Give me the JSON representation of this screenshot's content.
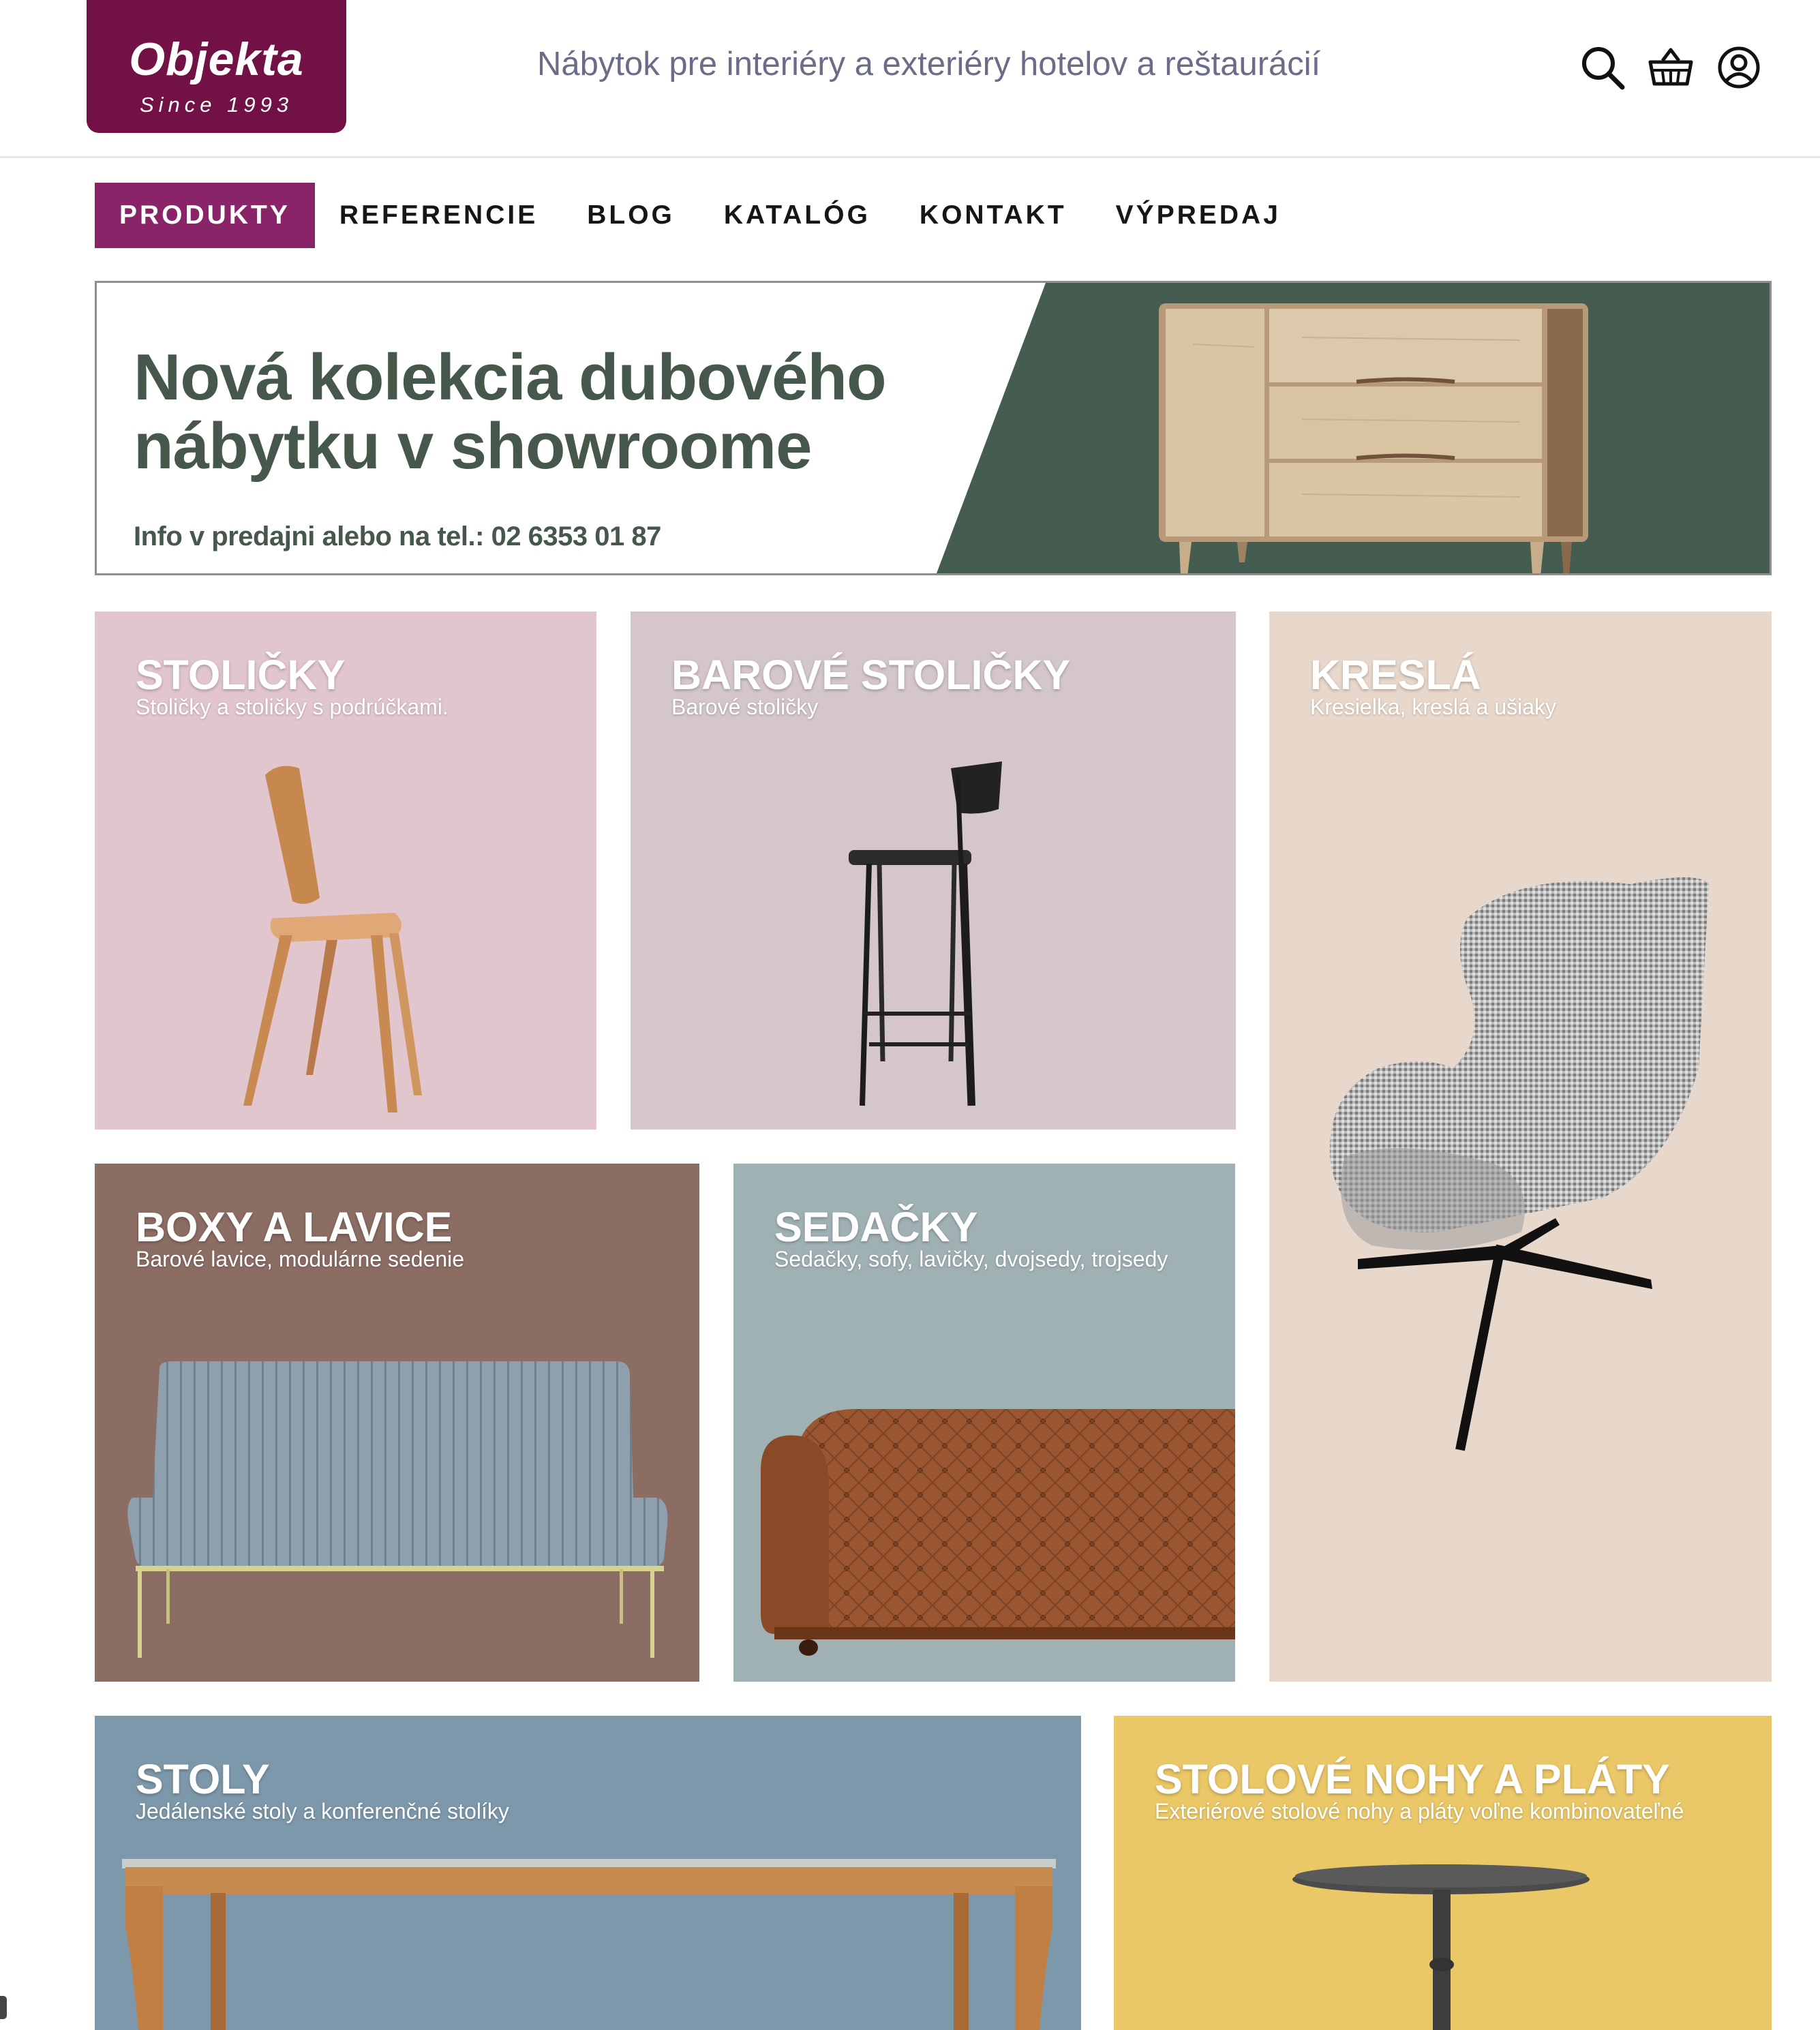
{
  "header": {
    "logo_name": "Objekta",
    "logo_since": "Since 1993",
    "tagline": "Nábytok pre interiéry a exteriéry hotelov a reštaurácií",
    "icons": [
      "search-icon",
      "basket-icon",
      "account-icon"
    ]
  },
  "nav": {
    "items": [
      "PRODUKTY",
      "REFERENCIE",
      "BLOG",
      "KATALÓG",
      "KONTAKT",
      "VÝPREDAJ"
    ],
    "active": "PRODUKTY"
  },
  "banner": {
    "title_line1": "Nová kolekcia dubového",
    "title_line2": "nábytku v showroome",
    "info": "Info v predajni alebo na tel.: 02 6353 01 87"
  },
  "categories": [
    {
      "title": "STOLIČKY",
      "subtitle": "Stoličky a stoličky s podrúčkami.",
      "color": "#e2c6cd"
    },
    {
      "title": "BAROVÉ STOLIČKY",
      "subtitle": "Barové stoličky",
      "color": "#d4c6c9"
    },
    {
      "title": "KRESLÁ",
      "subtitle": "Kresielka, kreslá a ušiaky",
      "color": "#e8d8cb"
    },
    {
      "title": "BOXY A LAVICE",
      "subtitle": "Barové lavice, modulárne sedenie",
      "color": "#8b6d64"
    },
    {
      "title": "SEDAČKY",
      "subtitle": "Sedačky, sofy, lavičky, dvojsedy, trojsedy",
      "color": "#a0b1b4"
    },
    {
      "title": "STOLY",
      "subtitle": "Jedálenské stoly a konferenčné stolíky",
      "color": "#7c98aa"
    },
    {
      "title": "STOLOVÉ NOHY A PLÁTY",
      "subtitle": "Exteriérové stolové nohy a pláty voľne kombinovateľné",
      "color": "#eac767"
    }
  ],
  "colors": {
    "brand": "#721146",
    "nav_active": "#8a2468",
    "banner_green": "#455c50"
  }
}
